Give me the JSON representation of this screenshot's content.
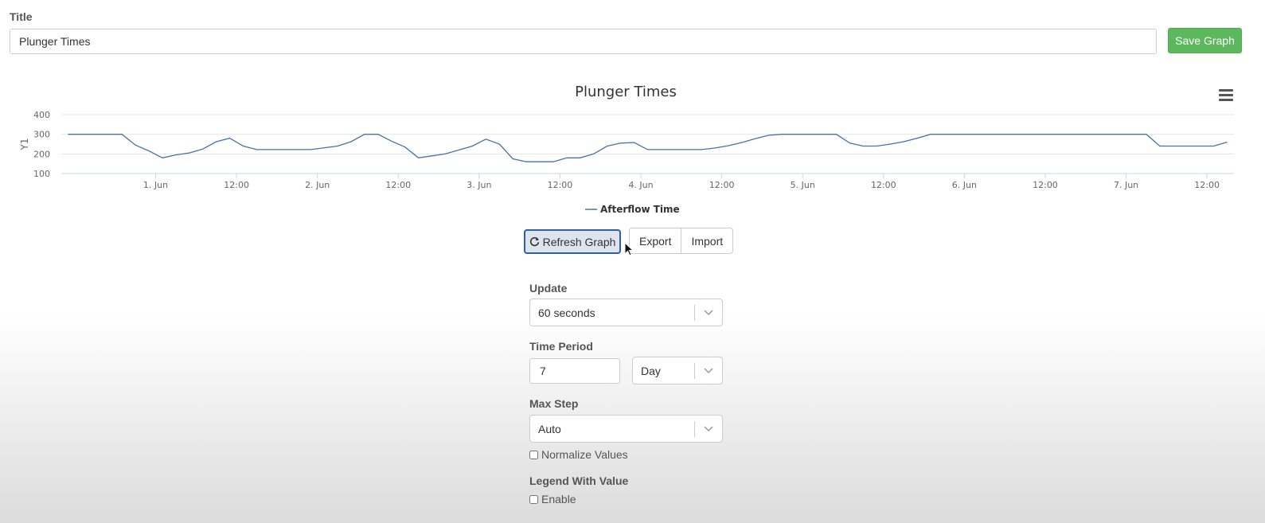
{
  "form": {
    "title_label": "Title",
    "title_value": "Plunger Times",
    "save_label": "Save Graph"
  },
  "chart_data": {
    "type": "line",
    "title": "Plunger Times",
    "ylabel": "Y1",
    "xlabel": "",
    "ylim": [
      100,
      400
    ],
    "yticks": [
      100,
      200,
      300,
      400
    ],
    "x_start": "2024-05-31T10:00",
    "x_end": "2024-06-07T16:00",
    "xticks": [
      {
        "t": "2024-06-01T00:00",
        "label": "1. Jun"
      },
      {
        "t": "2024-06-01T12:00",
        "label": "12:00"
      },
      {
        "t": "2024-06-02T00:00",
        "label": "2. Jun"
      },
      {
        "t": "2024-06-02T12:00",
        "label": "12:00"
      },
      {
        "t": "2024-06-03T00:00",
        "label": "3. Jun"
      },
      {
        "t": "2024-06-03T12:00",
        "label": "12:00"
      },
      {
        "t": "2024-06-04T00:00",
        "label": "4. Jun"
      },
      {
        "t": "2024-06-04T12:00",
        "label": "12:00"
      },
      {
        "t": "2024-06-05T00:00",
        "label": "5. Jun"
      },
      {
        "t": "2024-06-05T12:00",
        "label": "12:00"
      },
      {
        "t": "2024-06-06T00:00",
        "label": "6. Jun"
      },
      {
        "t": "2024-06-06T12:00",
        "label": "12:00"
      },
      {
        "t": "2024-06-07T00:00",
        "label": "7. Jun"
      },
      {
        "t": "2024-06-07T12:00",
        "label": "12:00"
      }
    ],
    "grid": true,
    "legend_position": "bottom-center",
    "series": [
      {
        "name": "Afterflow Time",
        "color": "#4572a7",
        "points": [
          [
            "2024-05-31T11:00",
            300
          ],
          [
            "2024-05-31T15:00",
            300
          ],
          [
            "2024-05-31T19:00",
            300
          ],
          [
            "2024-05-31T21:00",
            245
          ],
          [
            "2024-05-31T23:00",
            215
          ],
          [
            "2024-06-01T01:00",
            180
          ],
          [
            "2024-06-01T03:00",
            195
          ],
          [
            "2024-06-01T05:00",
            205
          ],
          [
            "2024-06-01T07:00",
            225
          ],
          [
            "2024-06-01T09:00",
            262
          ],
          [
            "2024-06-01T11:00",
            280
          ],
          [
            "2024-06-01T13:00",
            240
          ],
          [
            "2024-06-01T15:00",
            222
          ],
          [
            "2024-06-01T19:00",
            222
          ],
          [
            "2024-06-01T23:00",
            222
          ],
          [
            "2024-06-02T03:00",
            240
          ],
          [
            "2024-06-02T05:00",
            262
          ],
          [
            "2024-06-02T07:00",
            300
          ],
          [
            "2024-06-02T09:00",
            300
          ],
          [
            "2024-06-02T11:00",
            265
          ],
          [
            "2024-06-02T13:00",
            235
          ],
          [
            "2024-06-02T15:00",
            180
          ],
          [
            "2024-06-02T17:00",
            190
          ],
          [
            "2024-06-02T19:00",
            200
          ],
          [
            "2024-06-02T21:00",
            220
          ],
          [
            "2024-06-02T23:00",
            240
          ],
          [
            "2024-06-03T01:00",
            275
          ],
          [
            "2024-06-03T03:00",
            250
          ],
          [
            "2024-06-03T05:00",
            175
          ],
          [
            "2024-06-03T07:00",
            160
          ],
          [
            "2024-06-03T09:00",
            160
          ],
          [
            "2024-06-03T11:00",
            160
          ],
          [
            "2024-06-03T13:00",
            180
          ],
          [
            "2024-06-03T15:00",
            180
          ],
          [
            "2024-06-03T17:00",
            200
          ],
          [
            "2024-06-03T19:00",
            240
          ],
          [
            "2024-06-03T21:00",
            255
          ],
          [
            "2024-06-03T23:00",
            258
          ],
          [
            "2024-06-04T01:00",
            222
          ],
          [
            "2024-06-04T05:00",
            222
          ],
          [
            "2024-06-04T09:00",
            222
          ],
          [
            "2024-06-04T11:00",
            230
          ],
          [
            "2024-06-04T13:00",
            242
          ],
          [
            "2024-06-04T15:00",
            258
          ],
          [
            "2024-06-04T17:00",
            278
          ],
          [
            "2024-06-04T19:00",
            295
          ],
          [
            "2024-06-04T21:00",
            300
          ],
          [
            "2024-06-05T01:00",
            300
          ],
          [
            "2024-06-05T05:00",
            300
          ],
          [
            "2024-06-05T07:00",
            255
          ],
          [
            "2024-06-05T09:00",
            240
          ],
          [
            "2024-06-05T11:00",
            240
          ],
          [
            "2024-06-05T13:00",
            250
          ],
          [
            "2024-06-05T15:00",
            262
          ],
          [
            "2024-06-05T17:00",
            280
          ],
          [
            "2024-06-05T19:00",
            300
          ],
          [
            "2024-06-06T00:00",
            300
          ],
          [
            "2024-06-06T06:00",
            300
          ],
          [
            "2024-06-06T12:00",
            300
          ],
          [
            "2024-06-06T18:00",
            300
          ],
          [
            "2024-06-07T00:00",
            300
          ],
          [
            "2024-06-07T03:00",
            300
          ],
          [
            "2024-06-07T05:00",
            240
          ],
          [
            "2024-06-07T09:00",
            240
          ],
          [
            "2024-06-07T13:00",
            240
          ],
          [
            "2024-06-07T15:00",
            260
          ]
        ]
      }
    ]
  },
  "toolbar": {
    "refresh_label": "Refresh Graph",
    "export_label": "Export",
    "import_label": "Import"
  },
  "settings": {
    "update_label": "Update",
    "update_value": "60 seconds",
    "time_period_label": "Time Period",
    "time_period_value": "7",
    "time_unit_value": "Day",
    "max_step_label": "Max Step",
    "max_step_value": "Auto",
    "normalize_label": "Normalize Values",
    "normalize_checked": false,
    "legend_value_label": "Legend With Value",
    "enable_label": "Enable",
    "enable_checked": false
  },
  "icons": {
    "menu": "hamburger-icon",
    "refresh": "refresh-icon",
    "select": "chevron-down-icon",
    "cursor": "mouse-pointer-icon"
  }
}
